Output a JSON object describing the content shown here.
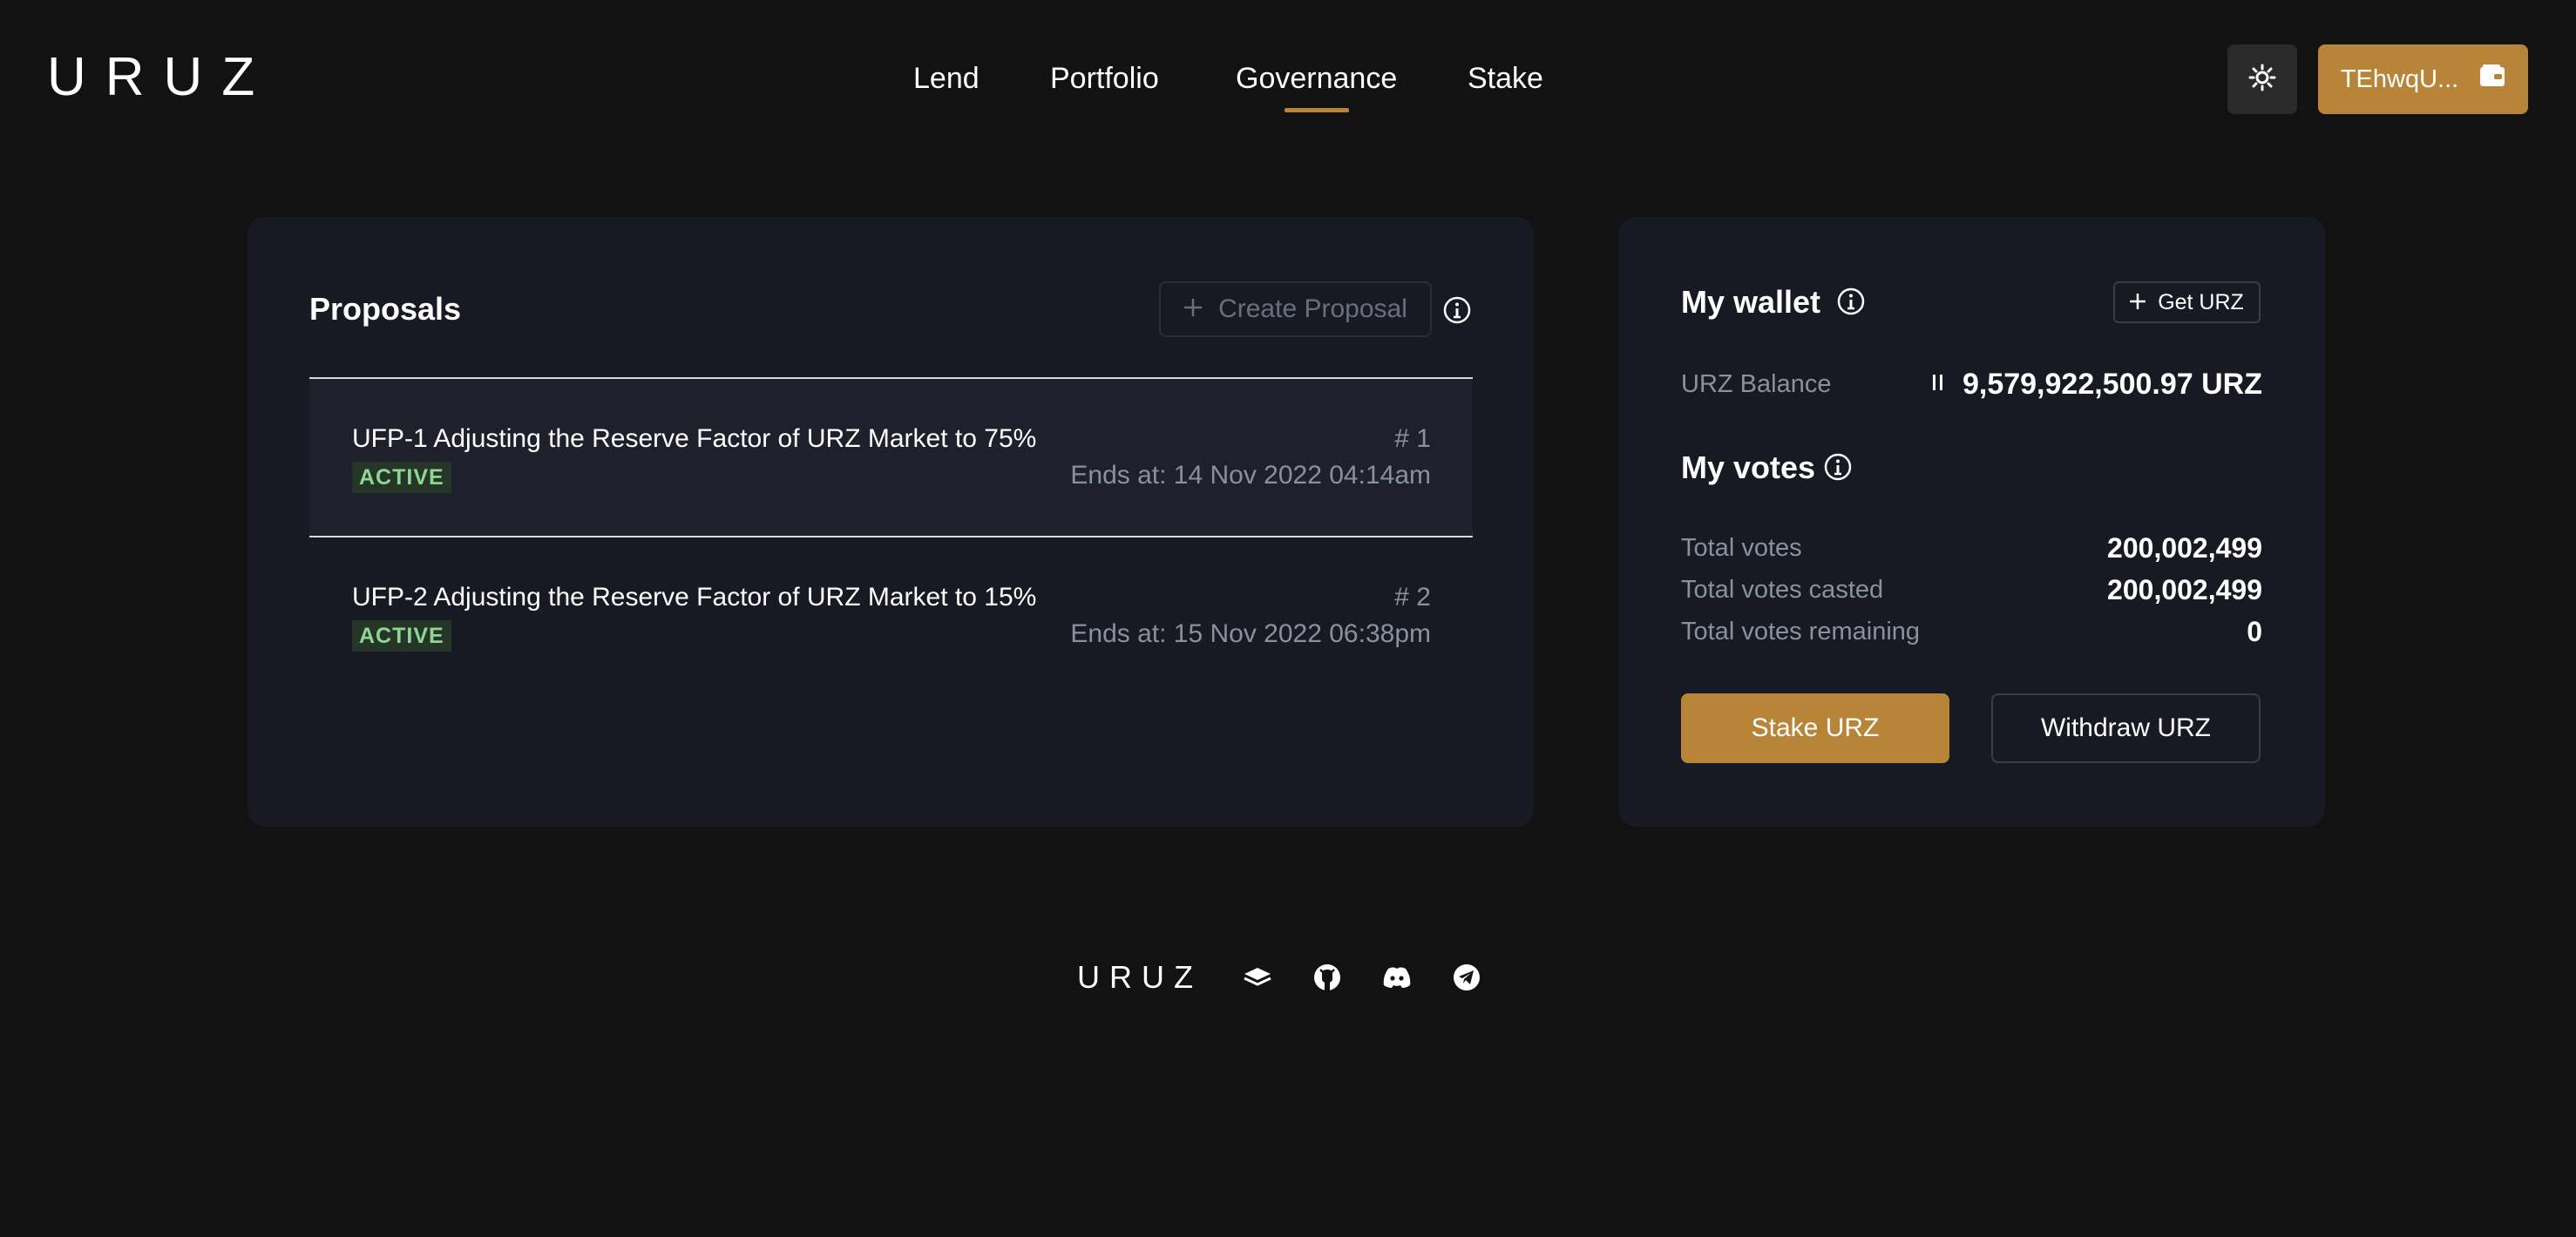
{
  "header": {
    "logo": "URUZ",
    "nav": [
      {
        "label": "Lend"
      },
      {
        "label": "Portfolio"
      },
      {
        "label": "Governance",
        "active": true
      },
      {
        "label": "Stake"
      }
    ],
    "theme_icon": "sun-icon",
    "wallet_address": "TEhwqU...",
    "wallet_icon": "wallet-icon"
  },
  "proposals": {
    "title": "Proposals",
    "create_label": "Create Proposal",
    "items": [
      {
        "title": "UFP-1 Adjusting the Reserve Factor of URZ Market to 75%",
        "status": "ACTIVE",
        "number": "# 1",
        "ends": "Ends at: 14 Nov 2022 04:14am"
      },
      {
        "title": "UFP-2 Adjusting the Reserve Factor of URZ Market to 15%",
        "status": "ACTIVE",
        "number": "# 2",
        "ends": "Ends at: 15 Nov 2022 06:38pm"
      }
    ]
  },
  "wallet": {
    "title": "My wallet",
    "get_label": "Get URZ",
    "balance_label": "URZ Balance",
    "balance_value": "9,579,922,500.97 URZ",
    "votes_title": "My votes",
    "total_votes_label": "Total votes",
    "total_votes_value": "200,002,499",
    "casted_label": "Total votes casted",
    "casted_value": "200,002,499",
    "remaining_label": "Total votes remaining",
    "remaining_value": "0",
    "stake_label": "Stake URZ",
    "withdraw_label": "Withdraw URZ"
  },
  "footer": {
    "logo": "URUZ",
    "icons": [
      "gitbook-icon",
      "github-icon",
      "discord-icon",
      "telegram-icon"
    ]
  },
  "colors": {
    "background": "#121212",
    "card": "#181a23",
    "accent": "#b88538",
    "muted_text": "#8c909b",
    "active_badge_bg": "#253528",
    "active_badge_text": "#8fd694"
  }
}
